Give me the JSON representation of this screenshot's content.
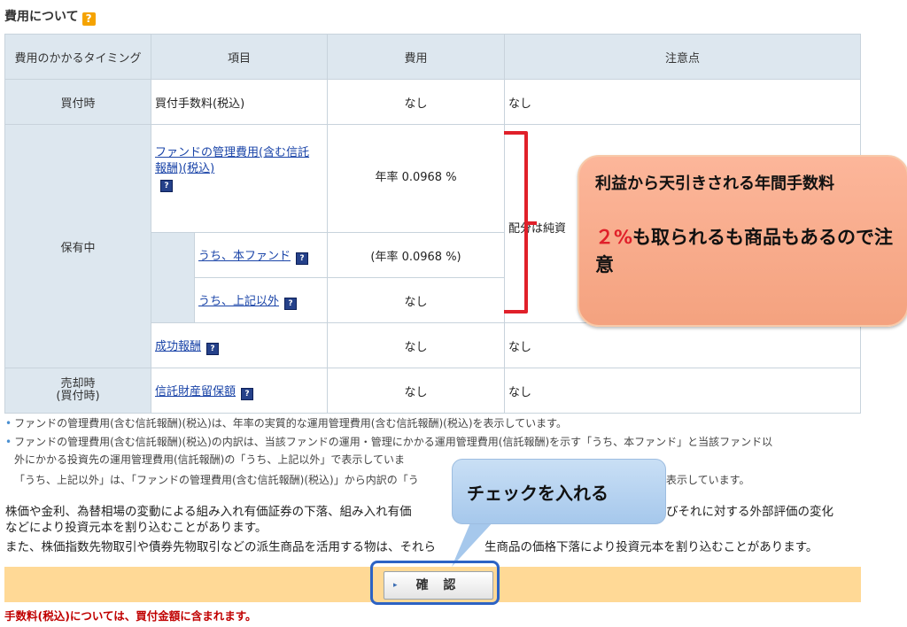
{
  "title": "費用について",
  "help_icon": "?",
  "table": {
    "headers": [
      "費用のかかるタイミング",
      "項目",
      "費用",
      "注意点"
    ],
    "rows": {
      "buy_timing": "買付時",
      "buy_item": "買付手数料(税込)",
      "buy_cost": "なし",
      "buy_note": "なし",
      "hold_timing": "保有中",
      "mgmt_item": "ファンドの管理費用(含む信託報酬)(税込)",
      "mgmt_cost": "年率 0.0968 %",
      "mgmt_note": "配分は純資",
      "main_fund_item": "うち、本ファンド",
      "main_fund_cost": "(年率 0.0968 %)",
      "other_item": "うち、上記以外",
      "other_cost": "なし",
      "perf_item": "成功報酬",
      "perf_cost": "なし",
      "perf_note": "なし",
      "sell_timing": "売却時\n(買付時)",
      "custody_item": "信託財産留保額",
      "custody_cost": "なし",
      "custody_note": "なし"
    }
  },
  "notes": {
    "note1": "ファンドの管理費用(含む信託報酬)(税込)は、年率の実質的な運用管理費用(含む信託報酬)(税込)を表示しています。",
    "note2a": "ファンドの管理費用(含む信託報酬)(税込)の内訳は、当該ファンドの運用・管理にかかる運用管理費用(信託報酬)を示す「うち、本ファンド」と当該ファンド以",
    "note2b": "外にかかる投資先の運用管理費用(信託報酬)の「うち、上記以外」で表示していま",
    "note2c_left": "「うち、上記以外」は、「ファンドの管理費用(含む信託報酬)(税込)」から内訳の「う",
    "note2c_right": "表示しています。"
  },
  "risk": {
    "line1_left": "株価や金利、為替相場の変動による組み入れ有価証券の下落、組み入れ有価",
    "line1_right": "びそれに対する外部評価の変化",
    "line2": "などにより投資元本を割り込むことがあります。",
    "line3_left": "また、株価指数先物取引や債券先物取引などの派生商品を活用する物は、それら",
    "line3_right": "生商品の価格下落により投資元本を割り込むことがあります。"
  },
  "confirm_button": "確 認",
  "confirm_arrow": "▸",
  "fee_note": "手数料(税込)については、買付金額に含まれます。",
  "callout_orange": {
    "line1": "利益から天引きされる年間手数料",
    "pct": "２%",
    "line2": "も取られるも商品もあるので注意"
  },
  "callout_blue": "チェックを入れる",
  "colors": {
    "header_bg": "#dde7ef",
    "link": "#1a44a8",
    "bar": "#ffd996",
    "fee_note": "#c00000",
    "bracket": "#e0202a",
    "orange_callout": "#f4a27f",
    "blue_callout": "#a6c8ec"
  },
  "icons": {
    "help": "question-box-icon",
    "bracket": "red-bracket-icon",
    "arrow": "triangle-right-icon"
  }
}
